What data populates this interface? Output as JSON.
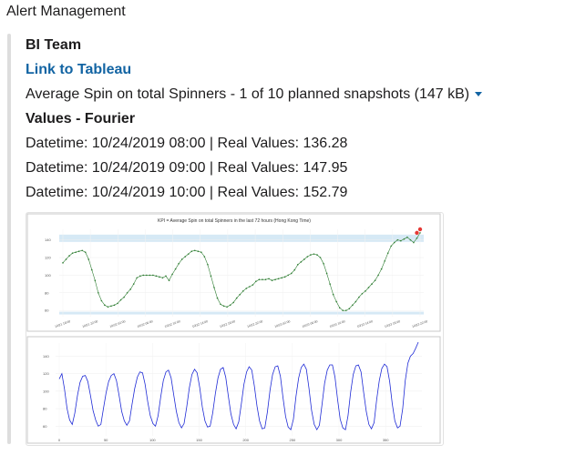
{
  "app": {
    "title": "Alert Management"
  },
  "message": {
    "team": "BI Team",
    "link_label": "Link to Tableau",
    "file_line": "Average Spin on total Spinners - 1 of 10 planned snapshots (147 kB)",
    "method": "Values - Fourier",
    "values": [
      "Datetime: 10/24/2019 08:00 | Real Values: 136.28",
      "Datetime: 10/24/2019 09:00 | Real Values: 147.95",
      "Datetime: 10/24/2019 10:00 | Real Values: 152.79"
    ]
  },
  "colors": {
    "link": "#1264a3",
    "top_line": "#2e7d32",
    "anomaly": "#e53935",
    "band": "#d6e9f5",
    "bottom_line": "#1f2bd6"
  },
  "chart_data": [
    {
      "type": "line",
      "title": "KPI = Average Spin on total Spinners in the last 72 hours (Hong Kong Time)",
      "xlabel": "",
      "ylabel": "",
      "x_ticks": [
        "10/21 18:00",
        "10/21 22:00",
        "10/22 02:00",
        "10/22 06:00",
        "10/22 10:00",
        "10/22 14:00",
        "10/22 18:00",
        "10/22 22:00",
        "10/23 02:00",
        "10/23 06:00",
        "10/23 10:00",
        "10/23 14:00",
        "10/23 18:00",
        "10/23 22:00"
      ],
      "y_ticks": [
        60,
        80,
        100,
        120,
        140
      ],
      "ylim": [
        55,
        152
      ],
      "band": [
        57,
        146
      ],
      "series": [
        {
          "values": [
            114,
            118,
            122,
            125,
            126,
            127,
            128,
            126,
            118,
            106,
            94,
            80,
            71,
            66,
            64,
            65,
            66,
            68,
            72,
            75,
            80,
            84,
            90,
            97,
            99,
            100,
            100,
            100,
            100,
            99,
            98,
            97,
            99,
            94,
            101,
            107,
            113,
            118,
            121,
            124,
            127,
            128,
            127,
            126,
            121,
            112,
            99,
            86,
            74,
            67,
            65,
            64,
            66,
            69,
            74,
            78,
            82,
            85,
            87,
            89,
            93,
            95,
            95,
            95,
            96,
            94,
            95,
            96,
            97,
            98,
            100,
            102,
            106,
            112,
            115,
            118,
            121,
            123,
            124,
            123,
            120,
            113,
            102,
            90,
            78,
            70,
            63,
            60,
            60,
            62,
            66,
            70,
            75,
            79,
            82,
            86,
            90,
            94,
            100,
            107,
            116,
            125,
            133,
            137,
            140,
            139,
            141,
            143,
            140,
            137,
            142,
            148
          ]
        }
      ],
      "anomalies": [
        {
          "index": 110,
          "value": 148
        },
        {
          "index": 111,
          "value": 152
        }
      ]
    },
    {
      "type": "line",
      "x_ticks": [
        0,
        50,
        100,
        150,
        200,
        250,
        300,
        350
      ],
      "y_ticks": [
        60,
        80,
        100,
        120,
        140
      ],
      "ylim": [
        52,
        155
      ],
      "series": [
        {
          "values": [
            114,
            120,
            103,
            80,
            67,
            62,
            75,
            95,
            110,
            117,
            118,
            111,
            95,
            78,
            67,
            60,
            62,
            80,
            98,
            111,
            118,
            120,
            112,
            95,
            77,
            66,
            61,
            66,
            85,
            103,
            116,
            122,
            121,
            108,
            88,
            72,
            63,
            60,
            72,
            93,
            112,
            122,
            124,
            115,
            96,
            77,
            64,
            58,
            63,
            82,
            104,
            119,
            125,
            121,
            104,
            82,
            66,
            59,
            60,
            75,
            97,
            115,
            125,
            127,
            116,
            94,
            74,
            62,
            57,
            65,
            86,
            108,
            122,
            128,
            124,
            106,
            83,
            66,
            57,
            58,
            76,
            101,
            119,
            128,
            129,
            117,
            93,
            71,
            59,
            56,
            68,
            94,
            115,
            127,
            131,
            125,
            103,
            78,
            62,
            56,
            61,
            85,
            109,
            124,
            130,
            130,
            116,
            90,
            68,
            58,
            56,
            72,
            99,
            119,
            129,
            130,
            122,
            99,
            77,
            62,
            57,
            64,
            90,
            112,
            126,
            131,
            128,
            111,
            86,
            66,
            58,
            60,
            80,
            112,
            132,
            140,
            143,
            149,
            156
          ]
        }
      ]
    }
  ]
}
